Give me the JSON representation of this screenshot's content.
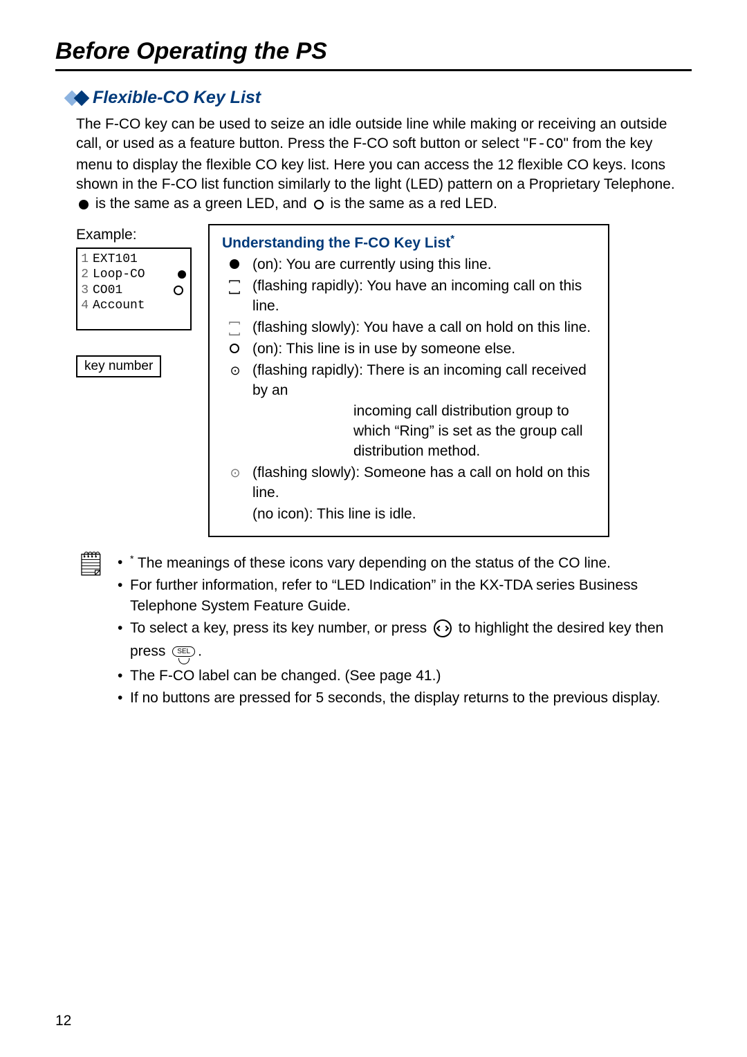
{
  "page_number": "12",
  "main_title": "Before Operating the PS",
  "sub_title": "Flexible-CO Key List",
  "intro": {
    "part1": "The F-CO key can be used to seize an idle outside line while making or receiving an outside call, or used as a feature button. Press the F-CO soft button or select \"",
    "mono": "F-CO",
    "part2": "\" from the key menu to display the flexible CO key list. Here you can access the 12 flexible CO keys. Icons shown in the F-CO list function similarly to the light (LED) pattern on a Proprietary Telephone. ",
    "part3": " is the same as a green LED, and ",
    "part4": " is the same as a red LED."
  },
  "example": {
    "label": "Example:",
    "rows": [
      {
        "num": "1",
        "label": "EXT101",
        "icon": ""
      },
      {
        "num": "2",
        "label": "Loop-CO",
        "icon": "dot"
      },
      {
        "num": "3",
        "label": "CO01",
        "icon": "flash-circ"
      },
      {
        "num": "4",
        "label": "Account",
        "icon": ""
      }
    ],
    "keynum_label": "key number"
  },
  "understanding": {
    "title": "Understanding the F-CO Key List",
    "star": "*",
    "items": [
      {
        "icon": "dot",
        "text": "(on): You are currently using this line."
      },
      {
        "icon": "dot-flash-fast",
        "text": "(flashing rapidly): You have an incoming call on this line."
      },
      {
        "icon": "dot-flash-slow",
        "text": "(flashing slowly): You have a call on hold on this line."
      },
      {
        "icon": "circ",
        "text": "(on): This line is in use by someone else."
      },
      {
        "icon": "circ-flash-fast",
        "text": "(flashing rapidly): There is an incoming call received by an"
      },
      {
        "icon": "",
        "text": "incoming call distribution group to which “Ring” is set as the group call distribution method.",
        "cont": true
      },
      {
        "icon": "circ-flash-slow",
        "text": "(flashing slowly): Someone has a call on hold on this line."
      },
      {
        "icon": "",
        "text": "(no icon): This line is idle."
      }
    ]
  },
  "notes": {
    "items": [
      {
        "kind": "star",
        "text": " The meanings of these icons vary depending on the status of the CO line."
      },
      {
        "kind": "plain",
        "text": "For further information, refer to “LED Indication” in the KX-TDA series Business Telephone System Feature Guide."
      },
      {
        "kind": "select",
        "pre": "To select a key, press its key number, or press ",
        "mid": " to highlight the desired key then press ",
        "post": "."
      },
      {
        "kind": "plain",
        "text": "The F-CO label can be changed. (See page 41.)"
      },
      {
        "kind": "plain",
        "text": "If no buttons are pressed for 5 seconds, the display returns to the previous display."
      }
    ],
    "sel_label": "SEL"
  }
}
